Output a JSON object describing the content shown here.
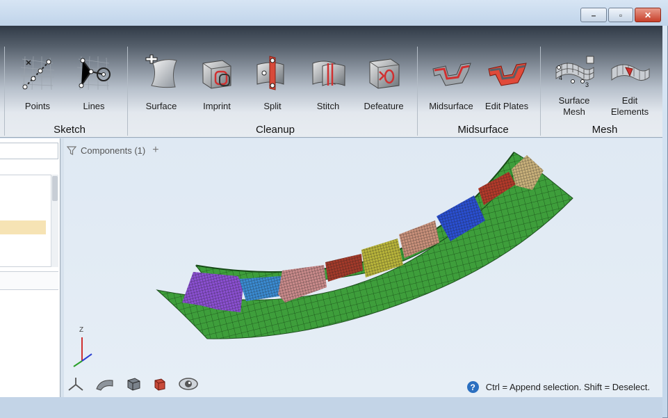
{
  "window": {
    "controls": {
      "minimize": "–",
      "maximize": "▫",
      "close": "✕"
    }
  },
  "ribbon": {
    "groups": [
      {
        "label": "Sketch",
        "tools": [
          {
            "label": "Points",
            "icon": "points-icon"
          },
          {
            "label": "Lines",
            "icon": "lines-icon"
          }
        ]
      },
      {
        "label": "Cleanup",
        "tools": [
          {
            "label": "Surface",
            "icon": "surface-icon"
          },
          {
            "label": "Imprint",
            "icon": "imprint-icon"
          },
          {
            "label": "Split",
            "icon": "split-icon"
          },
          {
            "label": "Stitch",
            "icon": "stitch-icon"
          },
          {
            "label": "Defeature",
            "icon": "defeature-icon"
          }
        ]
      },
      {
        "label": "Midsurface",
        "tools": [
          {
            "label": "Midsurface",
            "icon": "midsurface-icon"
          },
          {
            "label": "Edit Plates",
            "icon": "edit-plates-icon"
          }
        ]
      },
      {
        "label": "Mesh",
        "tools": [
          {
            "label": "Surface",
            "label2": "Mesh",
            "icon": "surface-mesh-icon"
          },
          {
            "label": "Edit",
            "label2": "Elements",
            "icon": "edit-elements-icon"
          }
        ]
      }
    ],
    "mesh_icon_numbers": {
      "a": "4",
      "b": "3"
    }
  },
  "viewport": {
    "components_filter": "Components (1)",
    "add_symbol": "+",
    "axis_label_z": "Z",
    "help_symbol": "?",
    "status_text": "Ctrl = Append selection. Shift = Deselect."
  },
  "colors": {
    "mesh_green": "#3a9b3a",
    "patch_purple": "#8a4fd0",
    "patch_blue": "#2a4fd0",
    "patch_red": "#b23a2a",
    "patch_yellow": "#b8b43a",
    "patch_pink": "#c88a8a",
    "patch_cyan": "#3a8ad0",
    "patch_tan": "#c8b07a"
  }
}
